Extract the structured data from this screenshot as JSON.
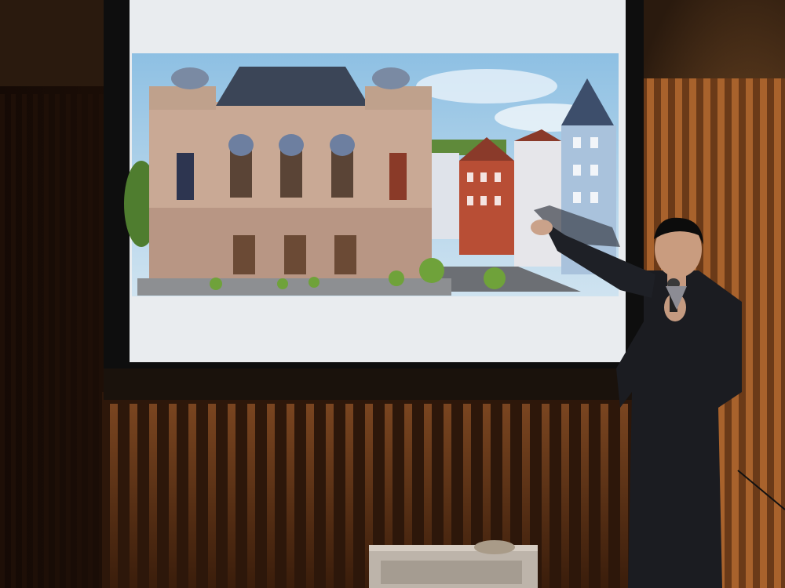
{
  "scene": {
    "subject": "presenter-pointing-at-projected-slide",
    "colors": {
      "wall": "#2a170b",
      "slat_light": "#c07a3a",
      "slat_dark": "#3a1f0d",
      "screen_frame": "#111111",
      "slide_white": "#eef0f2",
      "sky": "#9ec9e6",
      "building_stone": "#c7a995",
      "roof": "#3c4455",
      "red_houses": "#b5533b",
      "suit": "#1d1e22"
    }
  }
}
